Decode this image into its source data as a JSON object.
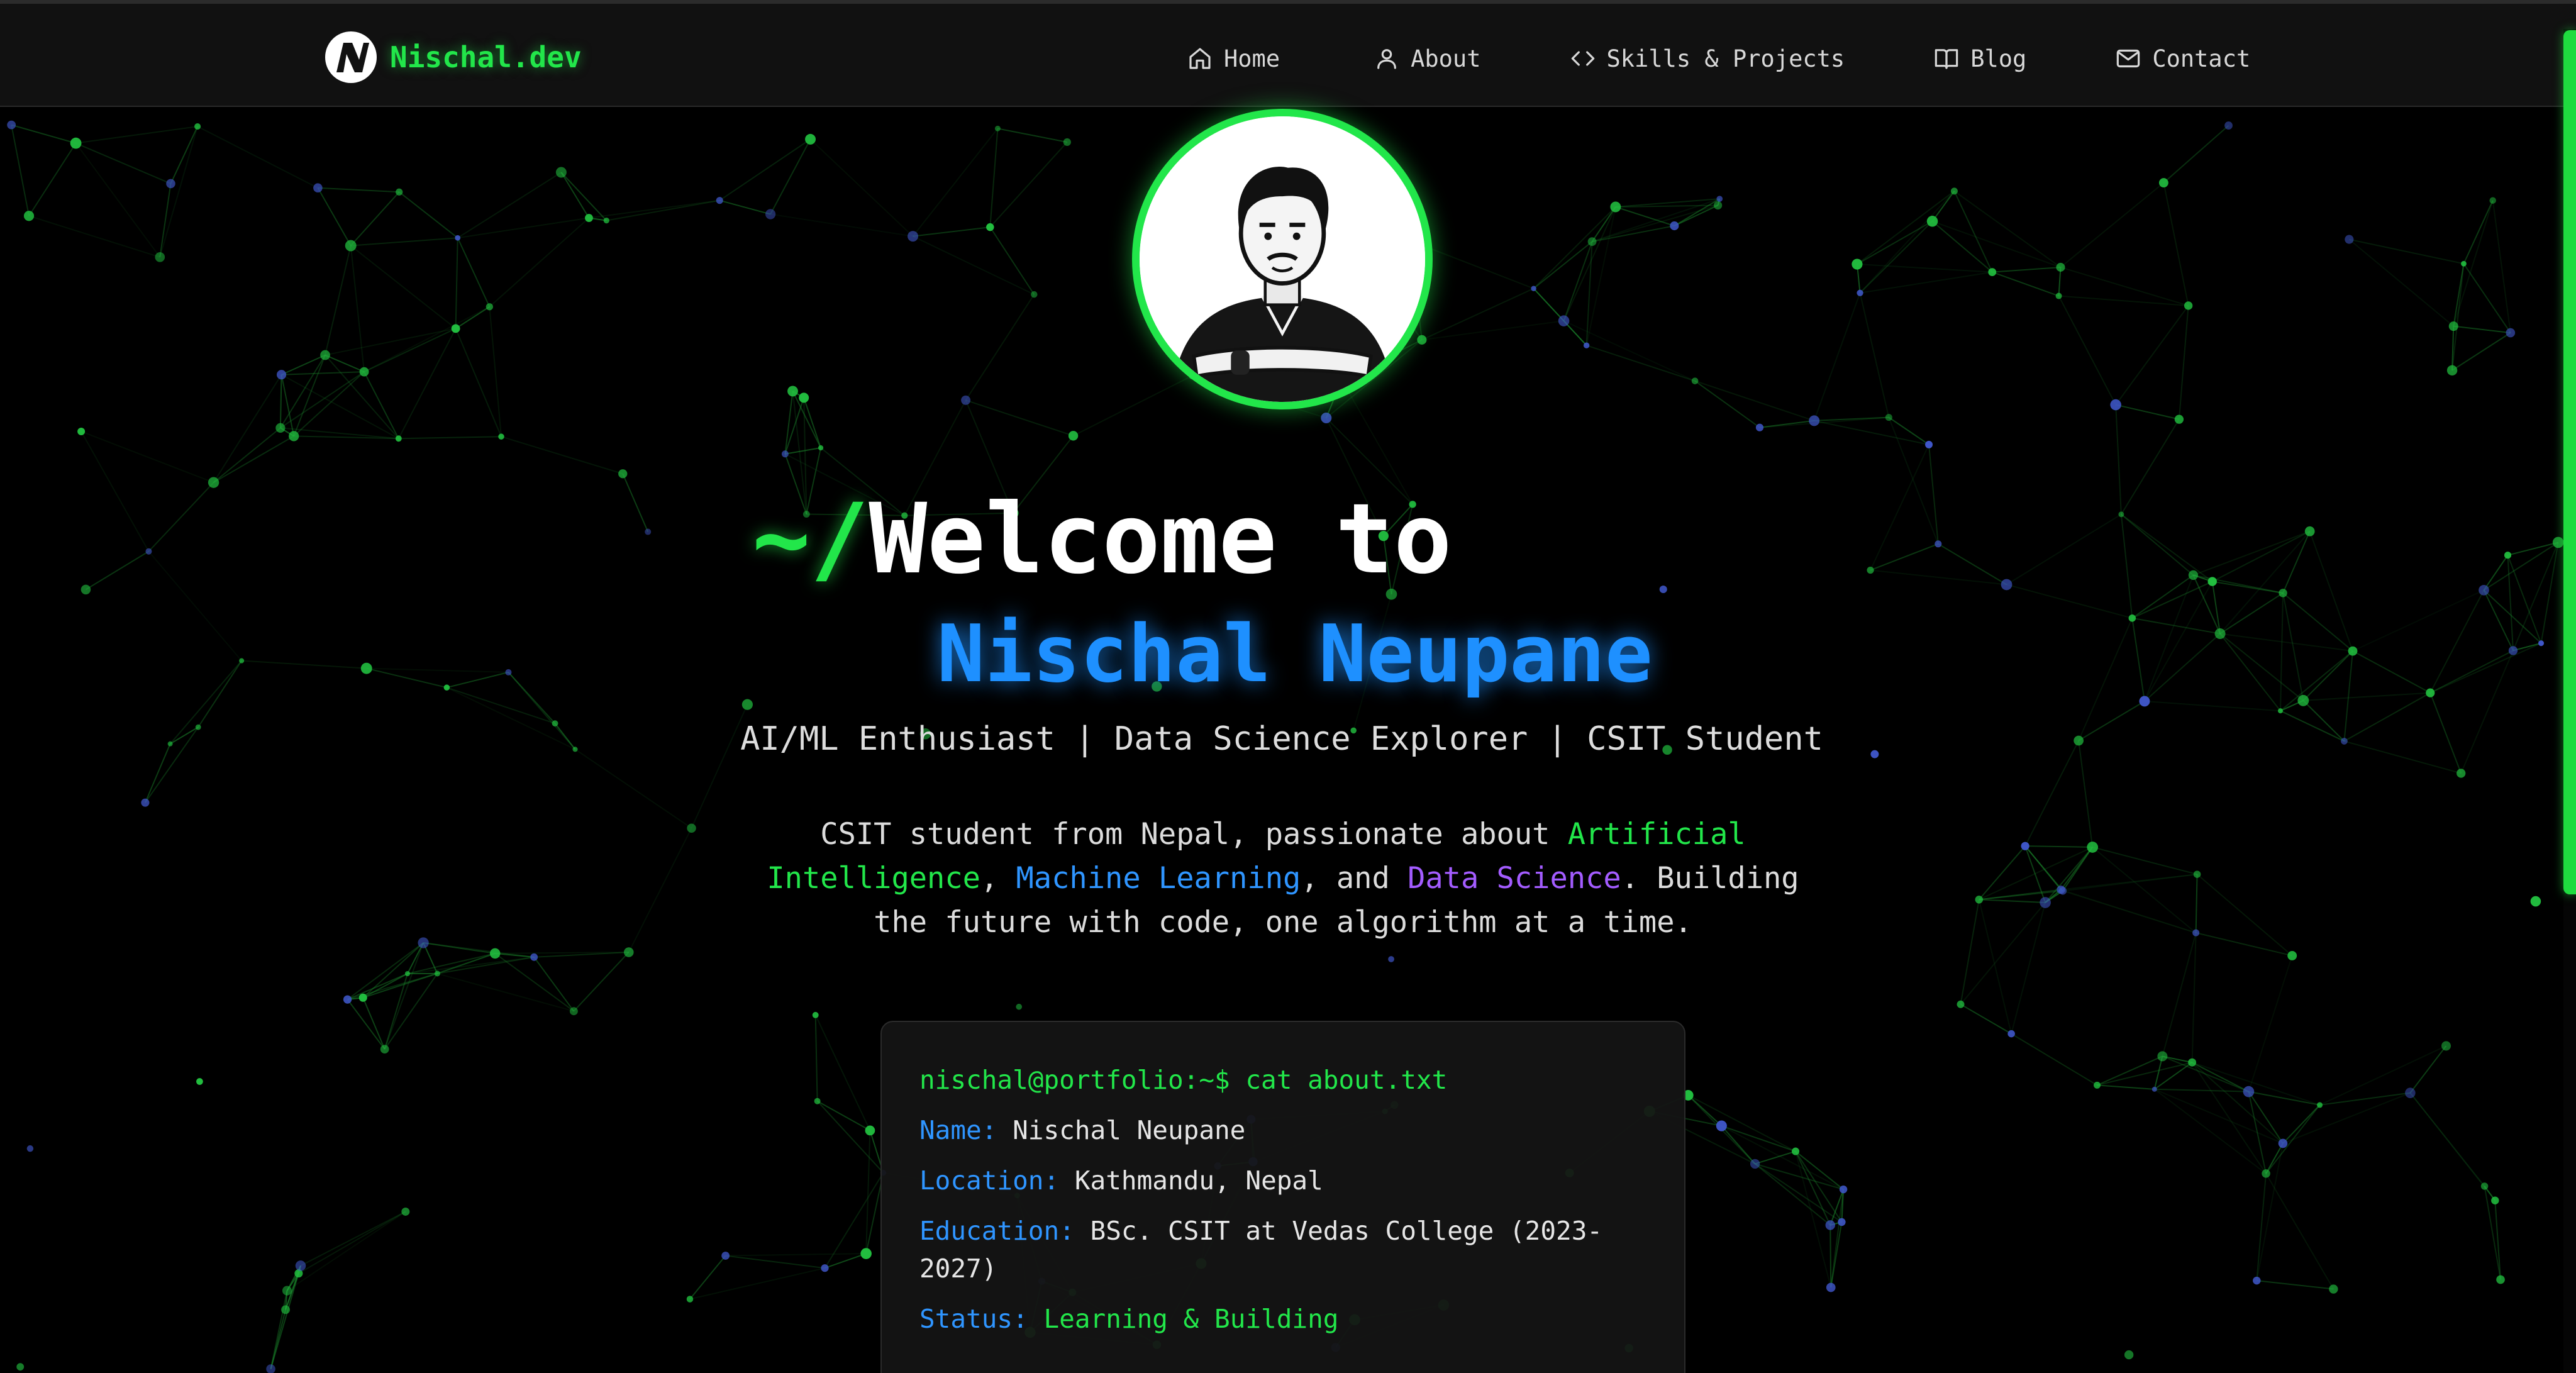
{
  "brand": {
    "name": "Nischal.dev"
  },
  "nav": {
    "items": [
      {
        "label": "Home",
        "icon": "home-icon"
      },
      {
        "label": "About",
        "icon": "user-icon"
      },
      {
        "label": "Skills & Projects",
        "icon": "code-icon"
      },
      {
        "label": "Blog",
        "icon": "book-icon"
      },
      {
        "label": "Contact",
        "icon": "mail-icon"
      }
    ]
  },
  "hero": {
    "prompt": "~/",
    "welcome": "Welcome to",
    "name": "Nischal Neupane",
    "tagline": "AI/ML Enthusiast | Data Science Explorer | CSIT Student",
    "intro": {
      "part1": "CSIT student from Nepal, passionate about ",
      "hl_ai": "Artificial Intelligence",
      "sep1": ", ",
      "hl_ml": "Machine Learning",
      "sep2": ", and ",
      "hl_ds": "Data Science",
      "part2": ". Building the future with code, one algorithm at a time."
    }
  },
  "terminal": {
    "command": "nischal@portfolio:~$ cat about.txt",
    "name_label": "Name:",
    "name_value": "Nischal Neupane",
    "location_label": "Location:",
    "location_value": "Kathmandu, Nepal",
    "education_label": "Education:",
    "education_value": "BSc. CSIT at Vedas College (2023-2027)",
    "status_label": "Status:",
    "status_value": "Learning & Building"
  },
  "colors": {
    "accent_green": "#22e64a",
    "accent_blue": "#1e90ff",
    "accent_purple": "#a35cff",
    "background": "#000000"
  }
}
